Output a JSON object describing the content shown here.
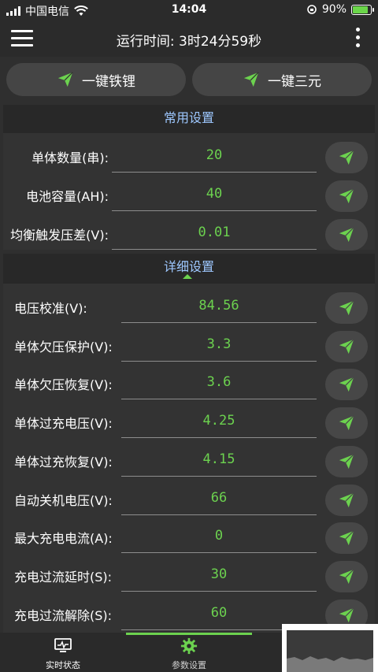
{
  "status_bar": {
    "carrier": "中国电信",
    "time": "14:04",
    "battery_percent": "90%",
    "battery_level": 0.9
  },
  "header": {
    "runtime_label": "运行时间:",
    "runtime_value": "3时24分59秒"
  },
  "top_buttons": {
    "lifepo4_label": "一键铁锂",
    "ternary_label": "一键三元"
  },
  "common_settings": {
    "title": "常用设置",
    "rows": [
      {
        "label": "单体数量(串):",
        "value": "20"
      },
      {
        "label": "电池容量(AH):",
        "value": "40"
      },
      {
        "label": "均衡触发压差(V):",
        "value": "0.01"
      }
    ]
  },
  "detail_settings": {
    "title": "详细设置",
    "rows": [
      {
        "label": "电压校准(V):",
        "value": "84.56"
      },
      {
        "label": "单体欠压保护(V):",
        "value": "3.3"
      },
      {
        "label": "单体欠压恢复(V):",
        "value": "3.6"
      },
      {
        "label": "单体过充电压(V):",
        "value": "4.25"
      },
      {
        "label": "单体过充恢复(V):",
        "value": "4.15"
      },
      {
        "label": "自动关机电压(V):",
        "value": "66"
      },
      {
        "label": "最大充电电流(A):",
        "value": "0"
      },
      {
        "label": "充电过流延时(S):",
        "value": "30"
      },
      {
        "label": "充电过流解除(S):",
        "value": "60"
      }
    ]
  },
  "bottom_nav": {
    "realtime_label": "实时状态",
    "params_label": "参数设置"
  },
  "colors": {
    "accent_green": "#6cd24f",
    "section_title_blue": "#9ec8ff",
    "background": "#2f2f2f"
  },
  "icons": {
    "send": "paper-plane-icon",
    "menu": "hamburger-icon",
    "more": "vertical-dots-icon",
    "realtime": "monitor-icon",
    "params": "gear-icon"
  }
}
